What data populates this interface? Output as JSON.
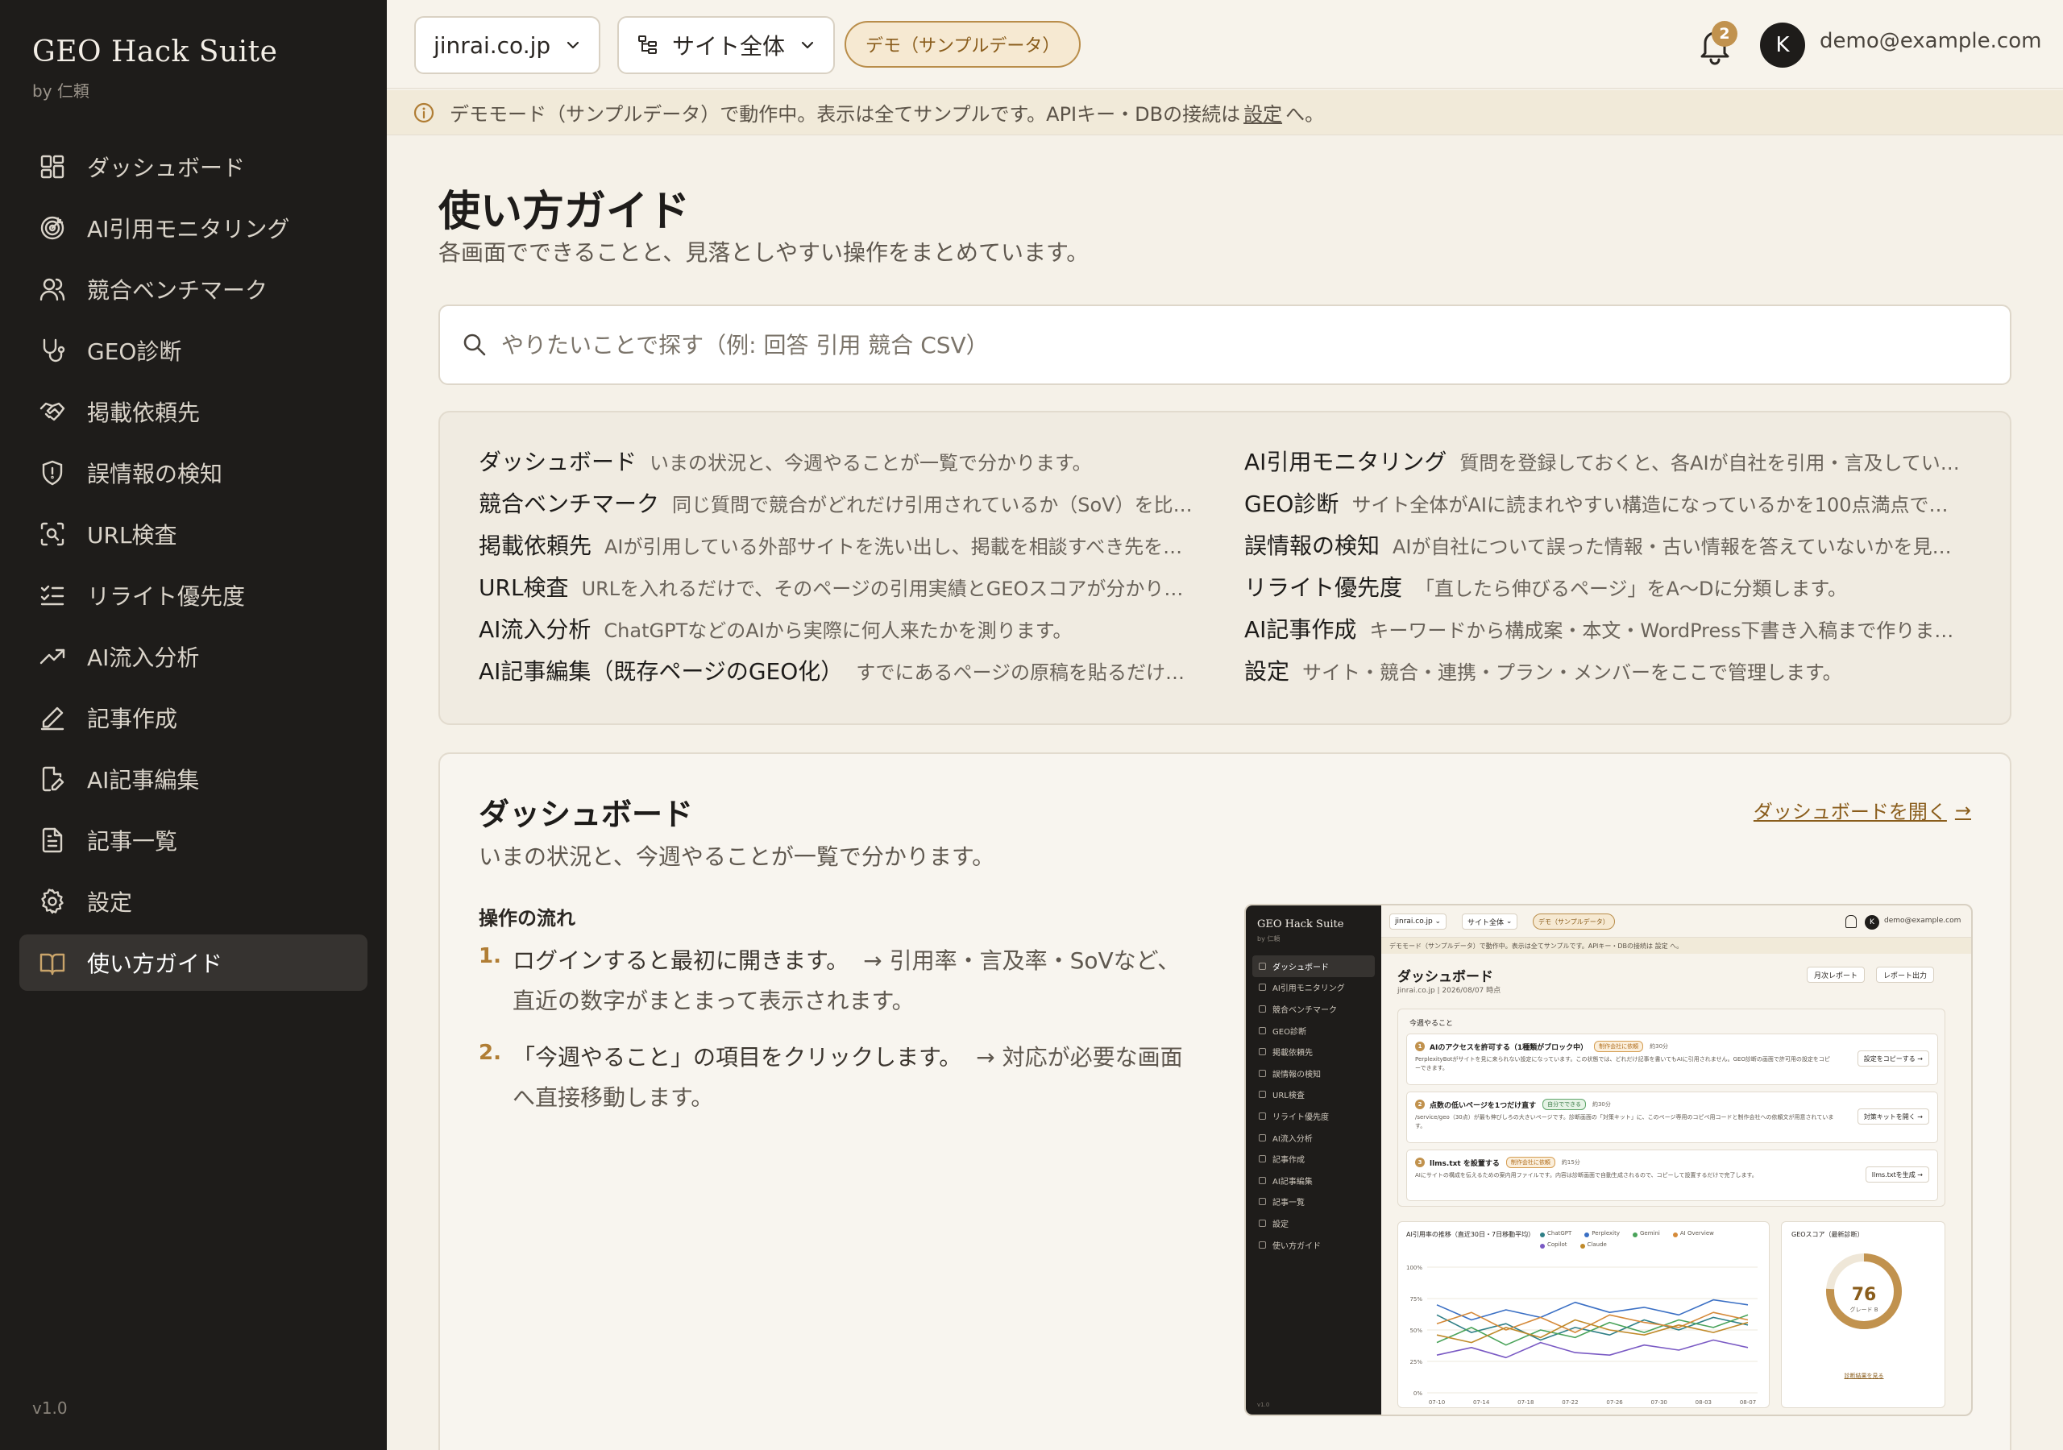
{
  "app": {
    "title": "GEO Hack Suite",
    "subtitle": "by 仁頼",
    "version": "v1.0"
  },
  "sidebar": {
    "items": [
      {
        "label": "ダッシュボード",
        "icon": "dashboard-icon",
        "active": false
      },
      {
        "label": "AI引用モニタリング",
        "icon": "target-icon",
        "active": false
      },
      {
        "label": "競合ベンチマーク",
        "icon": "users-icon",
        "active": false
      },
      {
        "label": "GEO診断",
        "icon": "stethoscope-icon",
        "active": false
      },
      {
        "label": "掲載依頼先",
        "icon": "handshake-icon",
        "active": false
      },
      {
        "label": "誤情報の検知",
        "icon": "shield-alert-icon",
        "active": false
      },
      {
        "label": "URL検査",
        "icon": "scan-search-icon",
        "active": false
      },
      {
        "label": "リライト優先度",
        "icon": "list-checks-icon",
        "active": false
      },
      {
        "label": "AI流入分析",
        "icon": "trending-up-icon",
        "active": false
      },
      {
        "label": "記事作成",
        "icon": "pen-icon",
        "active": false
      },
      {
        "label": "AI記事編集",
        "icon": "file-pen-icon",
        "active": false
      },
      {
        "label": "記事一覧",
        "icon": "file-text-icon",
        "active": false
      },
      {
        "label": "設定",
        "icon": "gear-icon",
        "active": false
      },
      {
        "label": "使い方ガイド",
        "icon": "book-open-icon",
        "active": true
      }
    ]
  },
  "topbar": {
    "site_select": "jinrai.co.jp",
    "scope_select": "サイト全体",
    "demo_badge": "デモ（サンプルデータ）",
    "notification_count": "2",
    "avatar_initial": "K",
    "user_email": "demo@example.com"
  },
  "banner": {
    "text_before": "デモモード（サンプルデータ）で動作中。表示は全てサンプルです。APIキー・DBの接続は",
    "link": "設定",
    "text_after": "へ。"
  },
  "page": {
    "title": "使い方ガイド",
    "subtitle": "各画面でできることと、見落としやすい操作をまとめています。",
    "search_placeholder": "やりたいことで探す（例: 回答 引用 競合 CSV）"
  },
  "index": {
    "left": [
      {
        "name": "ダッシュボード",
        "desc": "いまの状況と、今週やることが一覧で分かります。"
      },
      {
        "name": "競合ベンチマーク",
        "desc": "同じ質問で競合がどれだけ引用されているか（SoV）を比…"
      },
      {
        "name": "掲載依頼先",
        "desc": "AIが引用している外部サイトを洗い出し、掲載を相談すべき先を…"
      },
      {
        "name": "URL検査",
        "desc": "URLを入れるだけで、そのページの引用実績とGEOスコアが分かり…"
      },
      {
        "name": "AI流入分析",
        "desc": "ChatGPTなどのAIから実際に何人来たかを測ります。"
      },
      {
        "name": "AI記事編集（既存ページのGEO化）",
        "desc": "すでにあるページの原稿を貼るだけ…"
      }
    ],
    "right": [
      {
        "name": "AI引用モニタリング",
        "desc": "質問を登録しておくと、各AIが自社を引用・言及してい…"
      },
      {
        "name": "GEO診断",
        "desc": "サイト全体がAIに読まれやすい構造になっているかを100点満点で…"
      },
      {
        "name": "誤情報の検知",
        "desc": "AIが自社について誤った情報・古い情報を答えていないかを見…"
      },
      {
        "name": "リライト優先度",
        "desc": "「直したら伸びるページ」をA〜Dに分類します。"
      },
      {
        "name": "AI記事作成",
        "desc": "キーワードから構成案・本文・WordPress下書き入稿まで作りま…"
      },
      {
        "name": "設定",
        "desc": "サイト・競合・連携・プラン・メンバーをここで管理します。"
      }
    ]
  },
  "section": {
    "title": "ダッシュボード",
    "subtitle": "いまの状況と、今週やることが一覧で分かります。",
    "open_link": "ダッシュボードを開く",
    "flow_title": "操作の流れ",
    "steps": [
      {
        "num": "1.",
        "text": "ログインすると最初に開きます。",
        "note": "→ 引用率・言及率・SoVなど、直近の数字がまとまって表示されます。"
      },
      {
        "num": "2.",
        "text": "「今週やること」の項目をクリックします。",
        "note": "→ 対応が必要な画面へ直接移動します。"
      }
    ]
  },
  "preview": {
    "brand": "GEO Hack Suite",
    "brand_sub": "by 仁頼",
    "version": "v1.0",
    "nav": [
      "ダッシュボード",
      "AI引用モニタリング",
      "競合ベンチマーク",
      "GEO診断",
      "掲載依頼先",
      "誤情報の検知",
      "URL検査",
      "リライト優先度",
      "AI流入分析",
      "記事作成",
      "AI記事編集",
      "記事一覧",
      "設定",
      "使い方ガイド"
    ],
    "site": "jinrai.co.jp",
    "scope": "サイト全体",
    "demo": "デモ（サンプルデータ）",
    "avatar": "K",
    "email": "demo@example.com",
    "banner": "デモモード（サンプルデータ）で動作中。表示は全てサンプルです。APIキー・DBの接続は 設定 へ。",
    "title": "ダッシュボード",
    "date": "jinrai.co.jp | 2026/08/07 時点",
    "btn_monthly": "月次レポート",
    "btn_export": "レポート出力",
    "todo_title": "今週やること",
    "tasks": [
      {
        "num": "1",
        "title": "AIのアクセスを許可する（1種類がブロック中）",
        "tag": "制作会社に依頼",
        "tag_type": "orange",
        "time": "約30分",
        "desc": "PerplexityBotがサイトを見に来られない設定になっています。この状態では、どれだけ記事を書いてもAIに引用されません。GEO診断の画面で許可用の設定をコピーできます。",
        "button": "設定をコピーする →"
      },
      {
        "num": "2",
        "title": "点数の低いページを1つだけ直す",
        "tag": "自分でできる",
        "tag_type": "green",
        "time": "約30分",
        "desc": "/service/geo（30点）が最も伸びしろの大きいページです。診断画面の「対策キット」に、このページ専用のコピペ用コードと制作会社への依頼文が用意されています。",
        "button": "対策キットを開く →"
      },
      {
        "num": "3",
        "title": "llms.txt を設置する",
        "tag": "制作会社に依頼",
        "tag_type": "orange",
        "time": "約15分",
        "desc": "AIにサイトの構成を伝えるための案内用ファイルです。内容は診断画面で自動生成されるので、コピーして設置するだけで完了します。",
        "button": "llms.txtを生成 →"
      }
    ],
    "chart_title": "AI引用率の推移（直近30日・7日移動平均）",
    "score_title": "GEOスコア（最新診断）",
    "score_value": "76",
    "score_grade": "グレード B",
    "score_link": "診断結果を見る"
  },
  "chart_data": {
    "type": "line",
    "title": "AI引用率の推移（直近30日・7日移動平均）",
    "x": [
      "07-10",
      "07-14",
      "07-18",
      "07-22",
      "07-26",
      "07-30",
      "08-03",
      "08-07"
    ],
    "y_ticks": [
      "100%",
      "75%",
      "50%",
      "25%",
      "0%"
    ],
    "ylim": [
      0,
      100
    ],
    "series": [
      {
        "name": "ChatGPT",
        "color": "#2f7f86",
        "values": [
          62,
          48,
          55,
          42,
          52,
          46,
          58,
          50,
          60,
          54
        ]
      },
      {
        "name": "Perplexity",
        "color": "#3a6fc4",
        "values": [
          70,
          58,
          66,
          60,
          72,
          64,
          68,
          62,
          74,
          70
        ]
      },
      {
        "name": "Gemini",
        "color": "#4aa35a",
        "values": [
          40,
          52,
          38,
          50,
          44,
          56,
          48,
          58,
          52,
          62
        ]
      },
      {
        "name": "AI Overview",
        "color": "#d58a3a",
        "values": [
          55,
          64,
          50,
          60,
          48,
          62,
          56,
          52,
          64,
          58
        ]
      },
      {
        "name": "Copilot",
        "color": "#7a5ac4",
        "values": [
          30,
          36,
          28,
          40,
          32,
          30,
          38,
          34,
          42,
          36
        ]
      },
      {
        "name": "Claude",
        "color": "#c08a2a",
        "values": [
          46,
          40,
          52,
          44,
          58,
          50,
          46,
          54,
          48,
          56
        ]
      }
    ],
    "gauge": {
      "value": 76,
      "max": 100
    }
  }
}
